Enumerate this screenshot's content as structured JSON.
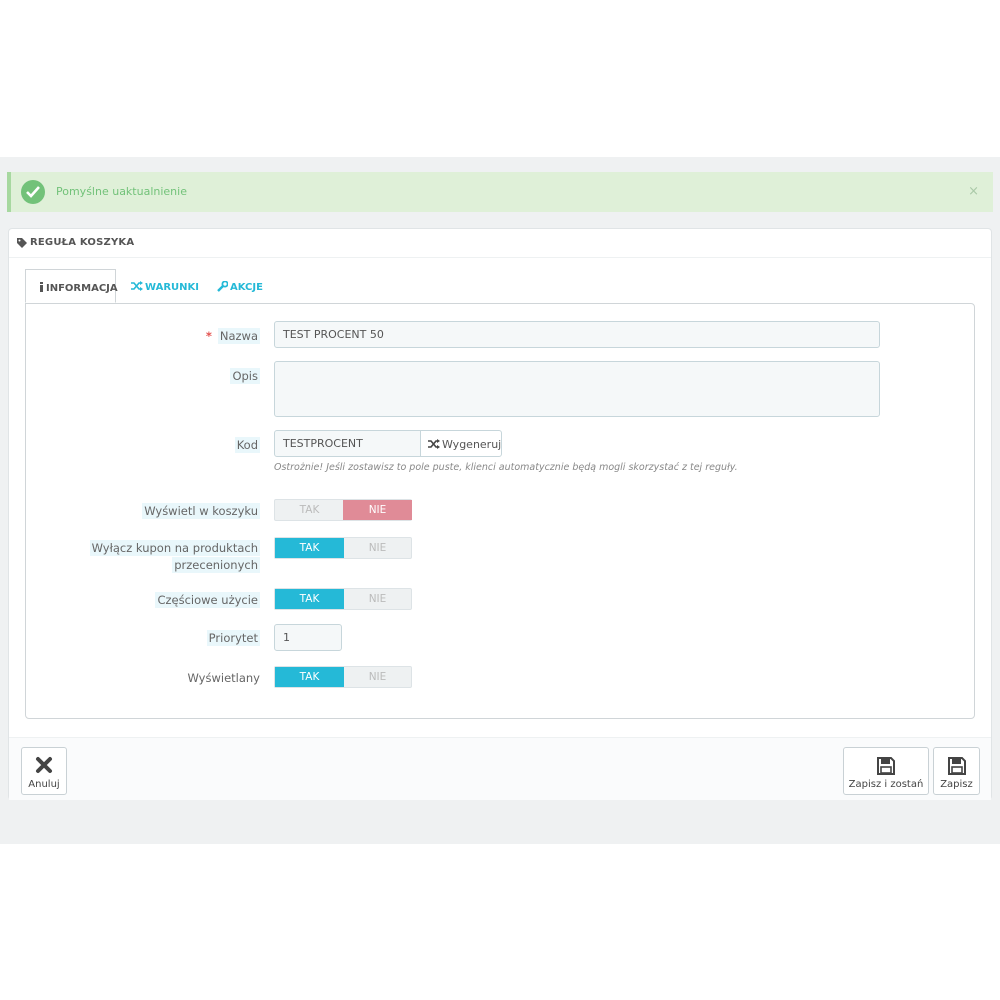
{
  "alert": {
    "message": "Pomyślne uaktualnienie",
    "close": "×"
  },
  "panel": {
    "title": "REGUŁA KOSZYKA"
  },
  "tabs": [
    {
      "label": "INFORMACJA",
      "icon": "info-icon",
      "active": true
    },
    {
      "label": "WARUNKI",
      "icon": "shuffle-icon",
      "active": false
    },
    {
      "label": "AKCJE",
      "icon": "wrench-icon",
      "active": false
    }
  ],
  "form": {
    "name": {
      "label": "Nazwa",
      "required": "*",
      "value": "TEST PROCENT 50"
    },
    "description": {
      "label": "Opis",
      "value": ""
    },
    "code": {
      "label": "Kod",
      "value": "TESTPROCENT",
      "generate": "Wygeneruj",
      "help": "Ostrożnie! Jeśli zostawisz to pole puste, klienci automatycznie będą mogli skorzystać z tej reguły."
    },
    "show_in_cart": {
      "label": "Wyświetl w koszyku",
      "yes": "TAK",
      "no": "NIE",
      "value": "NIE"
    },
    "exclude_discounted": {
      "label_line1": "Wyłącz kupon na produktach",
      "label_line2": "przecenionych",
      "yes": "TAK",
      "no": "NIE",
      "value": "TAK"
    },
    "partial_use": {
      "label": "Częściowe użycie",
      "yes": "TAK",
      "no": "NIE",
      "value": "TAK"
    },
    "priority": {
      "label": "Priorytet",
      "value": "1"
    },
    "active": {
      "label": "Wyświetlany",
      "yes": "TAK",
      "no": "NIE",
      "value": "TAK"
    }
  },
  "footer": {
    "cancel": "Anuluj",
    "save_stay": "Zapisz i zostań",
    "save": "Zapisz"
  },
  "colors": {
    "accent": "#25b9d7",
    "success": "#72c279",
    "danger_toggle": "#e08b97",
    "required": "#e3524f"
  }
}
